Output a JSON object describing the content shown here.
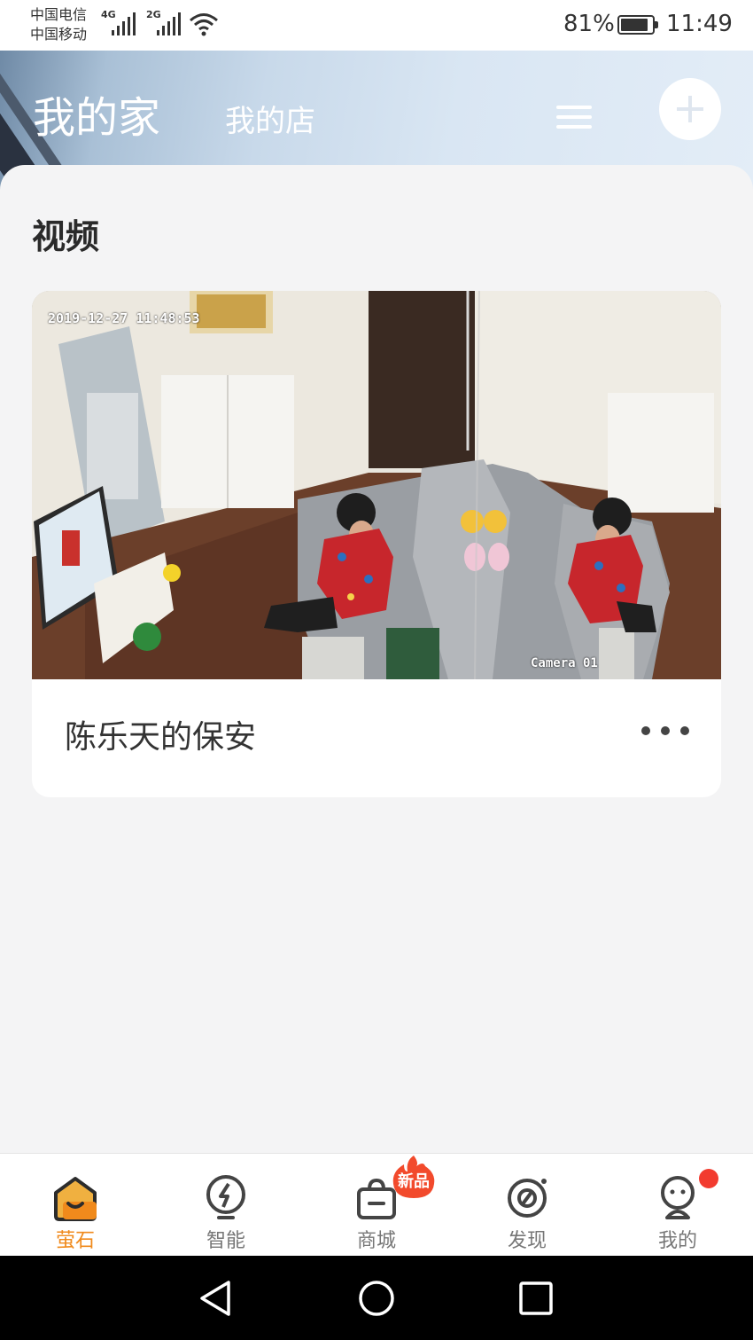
{
  "status_bar": {
    "carrier_1": "中国电信",
    "carrier_2": "中国移动",
    "net_1": "4G",
    "net_2": "2G",
    "battery_percent": "81%",
    "battery_level": 0.81,
    "time": "11:49"
  },
  "header": {
    "home_tab": "我的家",
    "shop_tab": "我的店",
    "menu_icon": "menu-icon",
    "add_icon": "plus-icon"
  },
  "section": {
    "title": "视频"
  },
  "device_card": {
    "timestamp_overlay": "2019-12-27 11:48:53",
    "camera_overlay": "Camera 01",
    "name": "陈乐天的保安",
    "more_icon": "more-dots-icon"
  },
  "tabbar": {
    "tabs": [
      {
        "label": "萤石",
        "icon": "home-icon",
        "active": true
      },
      {
        "label": "智能",
        "icon": "smart-bolt-icon",
        "active": false
      },
      {
        "label": "商城",
        "icon": "shop-bag-icon",
        "active": false
      },
      {
        "label": "发现",
        "icon": "discover-icon",
        "active": false
      },
      {
        "label": "我的",
        "icon": "profile-icon",
        "active": false
      }
    ],
    "new_badge": "新品",
    "accent_color": "#f08a1c",
    "badge_color": "#f23b2f"
  },
  "system_nav": {
    "back_icon": "back-triangle-icon",
    "home_icon": "home-circle-icon",
    "recents_icon": "recents-square-icon"
  }
}
